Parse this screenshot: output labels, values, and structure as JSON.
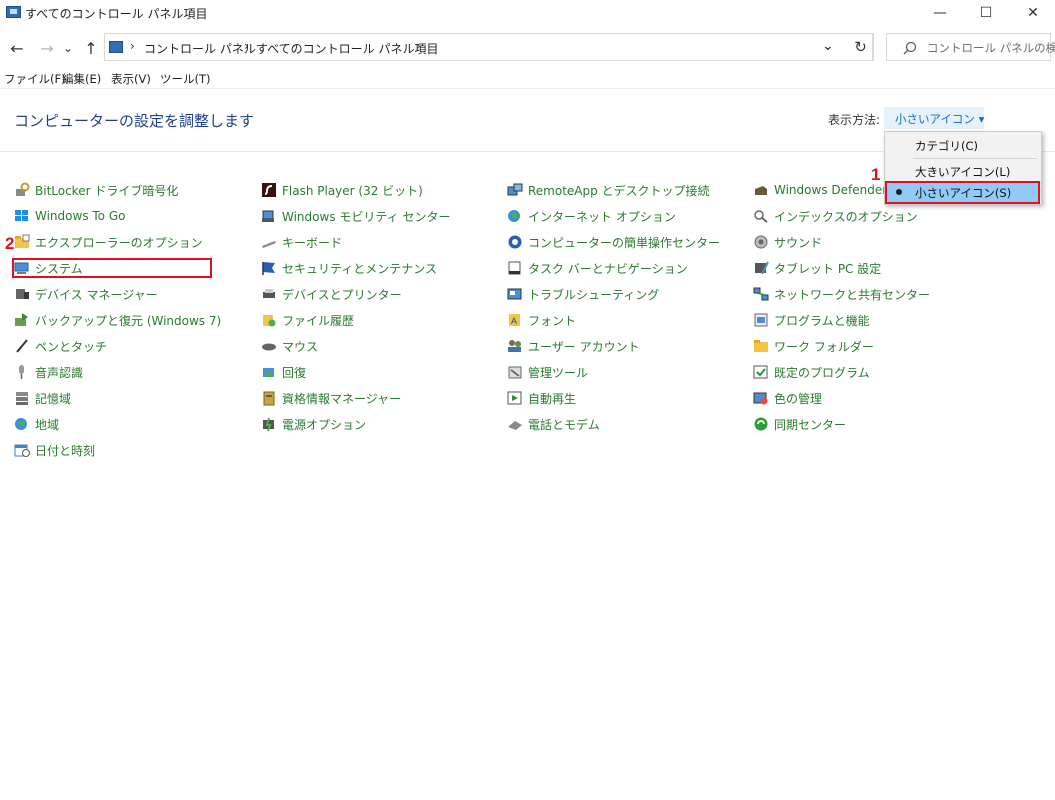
{
  "window": {
    "title": "すべてのコントロール パネル項目",
    "minimize": "—",
    "maximize": "☐",
    "close": "✕"
  },
  "nav": {
    "back": "←",
    "forward": "→",
    "recent": "⌄",
    "up": "↑",
    "refresh": "↻",
    "dropdown": "⌄"
  },
  "breadcrumb": [
    "コントロール パネル",
    "すべてのコントロール パネル項目"
  ],
  "search": {
    "placeholder": "コントロール パネルの検索"
  },
  "menu": [
    "ファイル(F)",
    "編集(E)",
    "表示(V)",
    "ツール(T)"
  ],
  "heading": "コンピューターの設定を調整します",
  "view_by": {
    "label": "表示方法:",
    "value": "小さいアイコン ▾"
  },
  "dropdown": {
    "options": [
      "カテゴリ(C)",
      "大きいアイコン(L)",
      "小さいアイコン(S)"
    ],
    "selected": "小さいアイコン(S)"
  },
  "annotations": [
    "1",
    "2"
  ],
  "items": {
    "col1": [
      {
        "label": "BitLocker ドライブ暗号化",
        "icon": "bitlocker-icon"
      },
      {
        "label": "Windows To Go",
        "icon": "windows-to-go-icon"
      },
      {
        "label": "エクスプローラーのオプション",
        "icon": "folder-options-icon"
      },
      {
        "label": "システム",
        "icon": "system-icon"
      },
      {
        "label": "デバイス マネージャー",
        "icon": "device-manager-icon"
      },
      {
        "label": "バックアップと復元 (Windows 7)",
        "icon": "backup-icon"
      },
      {
        "label": "ペンとタッチ",
        "icon": "pen-icon"
      },
      {
        "label": "音声認識",
        "icon": "microphone-icon"
      },
      {
        "label": "記憶域",
        "icon": "storage-icon"
      },
      {
        "label": "地域",
        "icon": "globe-clock-icon"
      },
      {
        "label": "日付と時刻",
        "icon": "calendar-icon"
      }
    ],
    "col2": [
      {
        "label": "Flash Player (32 ビット)",
        "icon": "flash-icon"
      },
      {
        "label": "Windows モビリティ センター",
        "icon": "mobility-icon"
      },
      {
        "label": "キーボード",
        "icon": "keyboard-icon"
      },
      {
        "label": "セキュリティとメンテナンス",
        "icon": "flag-icon"
      },
      {
        "label": "デバイスとプリンター",
        "icon": "printer-icon"
      },
      {
        "label": "ファイル履歴",
        "icon": "file-history-icon"
      },
      {
        "label": "マウス",
        "icon": "mouse-icon"
      },
      {
        "label": "回復",
        "icon": "recovery-icon"
      },
      {
        "label": "資格情報マネージャー",
        "icon": "credential-icon"
      },
      {
        "label": "電源オプション",
        "icon": "power-icon"
      }
    ],
    "col3": [
      {
        "label": "RemoteApp とデスクトップ接続",
        "icon": "remoteapp-icon"
      },
      {
        "label": "インターネット オプション",
        "icon": "internet-icon"
      },
      {
        "label": "コンピューターの簡単操作センター",
        "icon": "ease-of-access-icon"
      },
      {
        "label": "タスク バーとナビゲーション",
        "icon": "taskbar-icon"
      },
      {
        "label": "トラブルシューティング",
        "icon": "troubleshoot-icon"
      },
      {
        "label": "フォント",
        "icon": "font-icon"
      },
      {
        "label": "ユーザー アカウント",
        "icon": "users-icon"
      },
      {
        "label": "管理ツール",
        "icon": "admin-tools-icon"
      },
      {
        "label": "自動再生",
        "icon": "autoplay-icon"
      },
      {
        "label": "電話とモデム",
        "icon": "phone-modem-icon"
      }
    ],
    "col4": [
      {
        "label": "Windows Defender",
        "icon": "defender-icon"
      },
      {
        "label": "インデックスのオプション",
        "icon": "indexing-icon"
      },
      {
        "label": "サウンド",
        "icon": "sound-icon"
      },
      {
        "label": "タブレット PC 設定",
        "icon": "tablet-icon"
      },
      {
        "label": "ネットワークと共有センター",
        "icon": "network-icon"
      },
      {
        "label": "プログラムと機能",
        "icon": "programs-icon"
      },
      {
        "label": "ワーク フォルダー",
        "icon": "work-folders-icon"
      },
      {
        "label": "既定のプログラム",
        "icon": "default-programs-icon"
      },
      {
        "label": "色の管理",
        "icon": "color-management-icon"
      },
      {
        "label": "同期センター",
        "icon": "sync-center-icon"
      }
    ]
  }
}
